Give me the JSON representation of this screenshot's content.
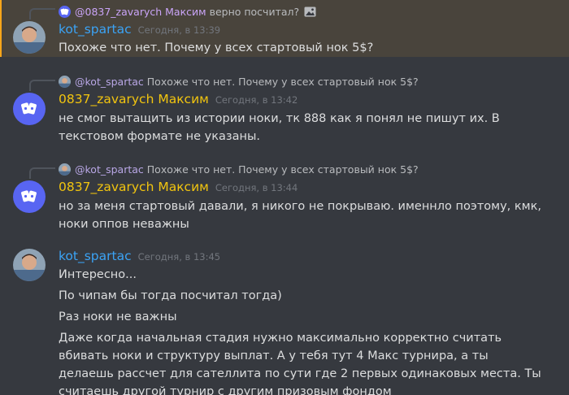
{
  "messages": [
    {
      "reply": {
        "author": "@0837_zavarych Максим",
        "text": "верно посчитал?",
        "has_image_icon": true
      },
      "author": "kot_spartac",
      "timestamp": "Сегодня, в 13:39",
      "lines": [
        "Похоже что нет. Почему у всех стартовый нок 5$?"
      ]
    },
    {
      "reply": {
        "author": "@kot_spartac",
        "text": "Похоже что нет. Почему у всех стартовый нок 5$?"
      },
      "author": "0837_zavarych Максим",
      "timestamp": "Сегодня, в 13:42",
      "lines": [
        "не смог вытащить из истории ноки, тк 888 как я понял не пишут их. В текстовом формате не указаны."
      ]
    },
    {
      "reply": {
        "author": "@kot_spartac",
        "text": "Похоже что нет. Почему у всех стартовый нок 5$?"
      },
      "author": "0837_zavarych Максим",
      "timestamp": "Сегодня, в 13:44",
      "lines": [
        "но за меня стартовый давали,  я никого не покрываю. именнло поэтому, кмк, ноки оппов неважны"
      ]
    },
    {
      "author": "kot_spartac",
      "timestamp": "Сегодня, в 13:45",
      "lines": [
        "Интересно...",
        "По чипам бы тогда посчитал тогда)",
        "Раз ноки не важны",
        "Даже когда начальная стадия нужно максимально корректно считать вбивать ноки и структуру выплат. А у тебя тут 4 Макс турнира, а ты делаешь рассчет для сателлита по сути где 2 первых одинаковых места. Ты считаешь другой турнир с другим призовым фондом"
      ]
    }
  ],
  "colors": {
    "background": "#36393f",
    "highlight": "#49443c",
    "accent": "#faa61a",
    "blurple": "#5865f2"
  }
}
